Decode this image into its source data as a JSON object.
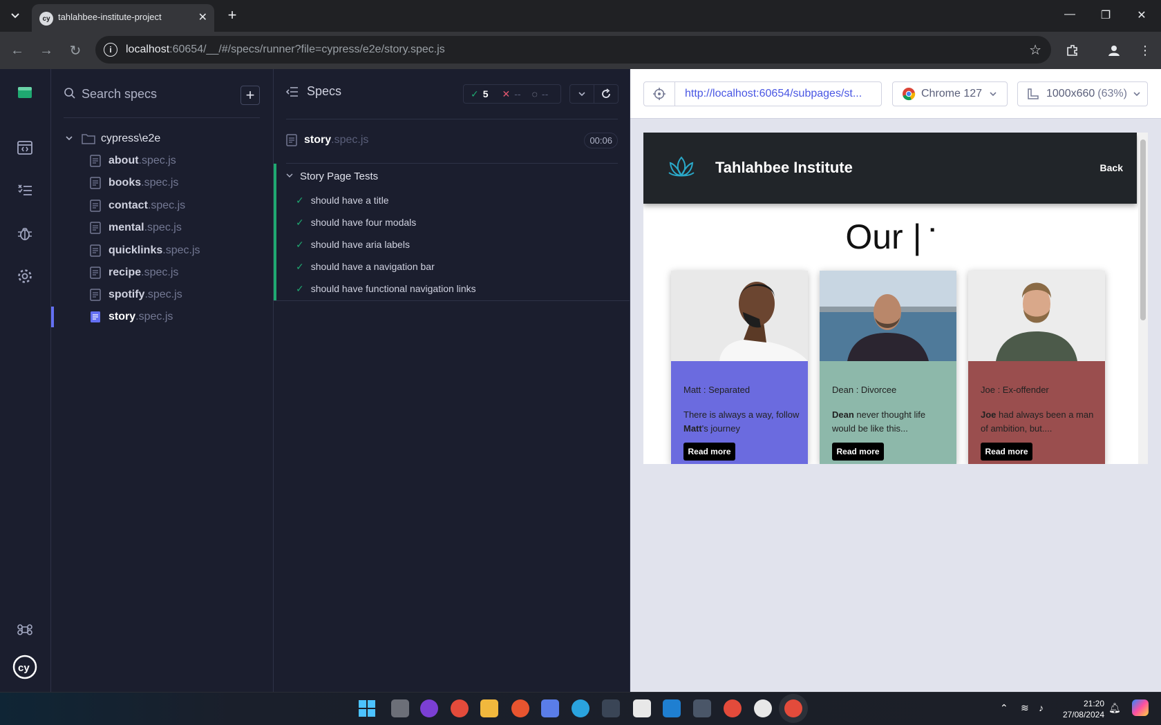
{
  "browser": {
    "tab_title": "tahlahbee-institute-project",
    "tab_favicon": "cy",
    "url_host": "localhost",
    "url_rest": ":60654/__/#/specs/runner?file=cypress/e2e/story.spec.js"
  },
  "specs_list": {
    "search_placeholder": "Search specs",
    "folder": "cypress\\e2e",
    "items": [
      {
        "name": "about",
        "ext": ".spec.js"
      },
      {
        "name": "books",
        "ext": ".spec.js"
      },
      {
        "name": "contact",
        "ext": ".spec.js"
      },
      {
        "name": "mental",
        "ext": ".spec.js"
      },
      {
        "name": "quicklinks",
        "ext": ".spec.js"
      },
      {
        "name": "recipe",
        "ext": ".spec.js"
      },
      {
        "name": "spotify",
        "ext": ".spec.js"
      },
      {
        "name": "story",
        "ext": ".spec.js"
      }
    ]
  },
  "reporter": {
    "header": "Specs",
    "passed": "5",
    "failed": "--",
    "pending": "--",
    "spec_name": "story",
    "spec_ext": ".spec.js",
    "duration": "00:06",
    "suite": "Story Page Tests",
    "tests": [
      "should have a title",
      "should have four modals",
      "should have aria labels",
      "should have a navigation bar",
      "should have functional navigation links"
    ]
  },
  "preview": {
    "url": "http://localhost:60654/subpages/st...",
    "browser": "Chrome 127",
    "viewport": "1000x660",
    "scale": "(63%)"
  },
  "site": {
    "name": "Tahlahbee Institute",
    "back": "Back",
    "heading": "Our |",
    "cards": [
      {
        "meta": "Matt : Separated",
        "desc_pre": "There is always a way, follow ",
        "desc_bold": "Matt",
        "desc_post": "'s journey",
        "button": "Read more",
        "color": "#6b6bdf"
      },
      {
        "meta": "Dean : Divorcee",
        "desc_pre": "",
        "desc_bold": "Dean",
        "desc_post": " never thought life would be like this...",
        "button": "Read more",
        "color": "#8db8aa"
      },
      {
        "meta": "Joe : Ex-offender",
        "desc_pre": "",
        "desc_bold": "Joe",
        "desc_post": " had always been a man of ambition, but....",
        "button": "Read more",
        "color": "#9a4e4e"
      }
    ]
  },
  "taskbar": {
    "time": "21:20",
    "date": "27/08/2024"
  },
  "colors": {
    "cypress_bg": "#1b1e2e",
    "pass_green": "#1fa971",
    "fail_red": "#e45770",
    "accent_indigo": "#6470f3"
  }
}
